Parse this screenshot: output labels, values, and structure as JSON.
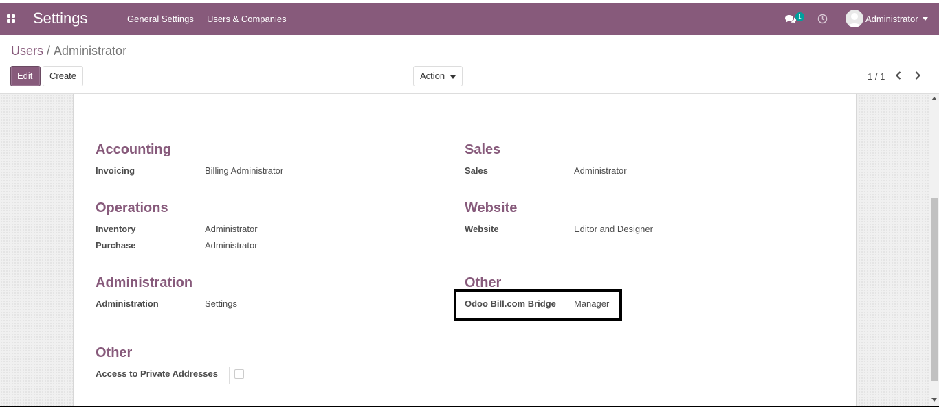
{
  "navbar": {
    "app_title": "Settings",
    "menus": [
      "General Settings",
      "Users & Companies"
    ],
    "messages_badge": "1",
    "user_name": "Administrator",
    "accent_color": "#875a7b"
  },
  "breadcrumb": {
    "parent": "Users",
    "separator": "/",
    "current": "Administrator"
  },
  "toolbar": {
    "edit_label": "Edit",
    "create_label": "Create",
    "action_label": "Action"
  },
  "pager": {
    "value": "1 / 1"
  },
  "access_rights": {
    "accounting": {
      "title": "Accounting",
      "rows": [
        {
          "label": "Invoicing",
          "value": "Billing Administrator"
        }
      ]
    },
    "sales": {
      "title": "Sales",
      "rows": [
        {
          "label": "Sales",
          "value": "Administrator"
        }
      ]
    },
    "operations": {
      "title": "Operations",
      "rows": [
        {
          "label": "Inventory",
          "value": "Administrator"
        },
        {
          "label": "Purchase",
          "value": "Administrator"
        }
      ]
    },
    "website": {
      "title": "Website",
      "rows": [
        {
          "label": "Website",
          "value": "Editor and Designer"
        }
      ]
    },
    "administration": {
      "title": "Administration",
      "rows": [
        {
          "label": "Administration",
          "value": "Settings"
        }
      ]
    },
    "other_apps": {
      "title": "Other",
      "rows": [
        {
          "label": "Odoo Bill.com Bridge",
          "value": "Manager"
        }
      ]
    },
    "other_technical": {
      "title": "Other",
      "rows": [
        {
          "label": "Access to Private Addresses",
          "checked": false
        }
      ]
    }
  }
}
